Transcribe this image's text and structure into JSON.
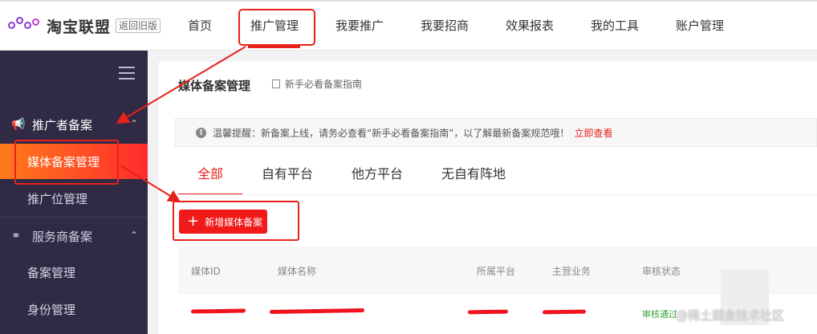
{
  "logo": {
    "text": "淘宝联盟",
    "old_version": "返回旧版"
  },
  "nav": {
    "items": [
      "首页",
      "推广管理",
      "我要推广",
      "我要招商",
      "效果报表",
      "我的工具",
      "账户管理"
    ],
    "active": "推广管理"
  },
  "sidebar": {
    "group1": "推广者备案",
    "group1_items": [
      "媒体备案管理",
      "推广位管理"
    ],
    "group2": "服务商备案",
    "group2_items": [
      "备案管理",
      "身份管理"
    ]
  },
  "main": {
    "title": "媒体备案管理",
    "guide": "新手必看备案指南",
    "notice": {
      "text": "温馨提醒：新备案上线，请务必查看“新手必看备案指南”，以了解最新备案规范哦！",
      "link": "立即查看"
    },
    "tabs": [
      "全部",
      "自有平台",
      "他方平台",
      "无自有阵地"
    ],
    "add_button": "新增媒体备案",
    "table": {
      "headers": [
        "媒体ID",
        "媒体名称",
        "所属平台",
        "主营业务",
        "审核状态"
      ],
      "status": "审核通过"
    }
  },
  "watermark": "@稀土掘金技术社区",
  "colors": {
    "accent": "#e8221b",
    "sidebar": "#302a45",
    "active_grad_start": "#ff7a1a"
  }
}
